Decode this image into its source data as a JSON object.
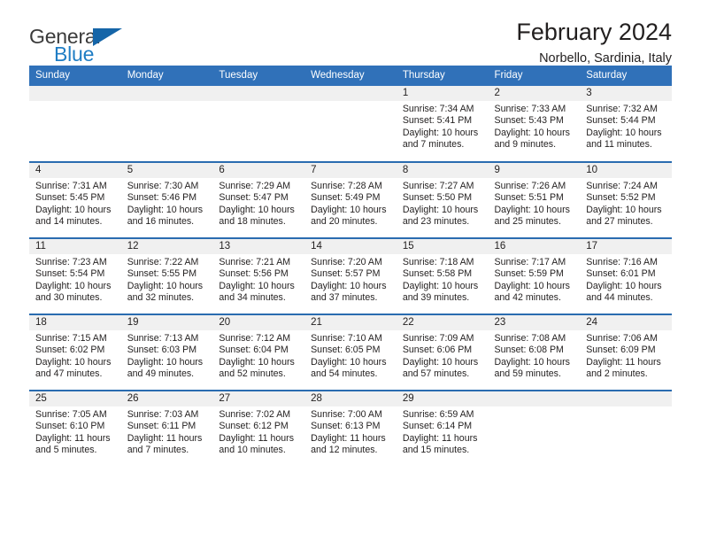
{
  "brand": {
    "name_top": "General",
    "name_bottom": "Blue",
    "triangle_icon": "triangle-icon",
    "color_dark": "#3b3b3b",
    "color_blue": "#1f7dc4",
    "triangle_color": "#1565a8"
  },
  "header": {
    "title": "February 2024",
    "subtitle": "Norbello, Sardinia, Italy"
  },
  "theme": {
    "header_bg": "#3071b9",
    "row_divider": "#2a6cb0",
    "day_band_bg": "#f0f0f0",
    "text": "#221f1f"
  },
  "weekday_headers": [
    "Sunday",
    "Monday",
    "Tuesday",
    "Wednesday",
    "Thursday",
    "Friday",
    "Saturday"
  ],
  "weeks": [
    [
      {
        "day": "",
        "empty": true,
        "line1": "",
        "line2": "",
        "line3": "",
        "line4": ""
      },
      {
        "day": "",
        "empty": true,
        "line1": "",
        "line2": "",
        "line3": "",
        "line4": ""
      },
      {
        "day": "",
        "empty": true,
        "line1": "",
        "line2": "",
        "line3": "",
        "line4": ""
      },
      {
        "day": "",
        "empty": true,
        "line1": "",
        "line2": "",
        "line3": "",
        "line4": ""
      },
      {
        "day": "1",
        "empty": false,
        "line1": "Sunrise: 7:34 AM",
        "line2": "Sunset: 5:41 PM",
        "line3": "Daylight: 10 hours",
        "line4": "and 7 minutes."
      },
      {
        "day": "2",
        "empty": false,
        "line1": "Sunrise: 7:33 AM",
        "line2": "Sunset: 5:43 PM",
        "line3": "Daylight: 10 hours",
        "line4": "and 9 minutes."
      },
      {
        "day": "3",
        "empty": false,
        "line1": "Sunrise: 7:32 AM",
        "line2": "Sunset: 5:44 PM",
        "line3": "Daylight: 10 hours",
        "line4": "and 11 minutes."
      }
    ],
    [
      {
        "day": "4",
        "empty": false,
        "line1": "Sunrise: 7:31 AM",
        "line2": "Sunset: 5:45 PM",
        "line3": "Daylight: 10 hours",
        "line4": "and 14 minutes."
      },
      {
        "day": "5",
        "empty": false,
        "line1": "Sunrise: 7:30 AM",
        "line2": "Sunset: 5:46 PM",
        "line3": "Daylight: 10 hours",
        "line4": "and 16 minutes."
      },
      {
        "day": "6",
        "empty": false,
        "line1": "Sunrise: 7:29 AM",
        "line2": "Sunset: 5:47 PM",
        "line3": "Daylight: 10 hours",
        "line4": "and 18 minutes."
      },
      {
        "day": "7",
        "empty": false,
        "line1": "Sunrise: 7:28 AM",
        "line2": "Sunset: 5:49 PM",
        "line3": "Daylight: 10 hours",
        "line4": "and 20 minutes."
      },
      {
        "day": "8",
        "empty": false,
        "line1": "Sunrise: 7:27 AM",
        "line2": "Sunset: 5:50 PM",
        "line3": "Daylight: 10 hours",
        "line4": "and 23 minutes."
      },
      {
        "day": "9",
        "empty": false,
        "line1": "Sunrise: 7:26 AM",
        "line2": "Sunset: 5:51 PM",
        "line3": "Daylight: 10 hours",
        "line4": "and 25 minutes."
      },
      {
        "day": "10",
        "empty": false,
        "line1": "Sunrise: 7:24 AM",
        "line2": "Sunset: 5:52 PM",
        "line3": "Daylight: 10 hours",
        "line4": "and 27 minutes."
      }
    ],
    [
      {
        "day": "11",
        "empty": false,
        "line1": "Sunrise: 7:23 AM",
        "line2": "Sunset: 5:54 PM",
        "line3": "Daylight: 10 hours",
        "line4": "and 30 minutes."
      },
      {
        "day": "12",
        "empty": false,
        "line1": "Sunrise: 7:22 AM",
        "line2": "Sunset: 5:55 PM",
        "line3": "Daylight: 10 hours",
        "line4": "and 32 minutes."
      },
      {
        "day": "13",
        "empty": false,
        "line1": "Sunrise: 7:21 AM",
        "line2": "Sunset: 5:56 PM",
        "line3": "Daylight: 10 hours",
        "line4": "and 34 minutes."
      },
      {
        "day": "14",
        "empty": false,
        "line1": "Sunrise: 7:20 AM",
        "line2": "Sunset: 5:57 PM",
        "line3": "Daylight: 10 hours",
        "line4": "and 37 minutes."
      },
      {
        "day": "15",
        "empty": false,
        "line1": "Sunrise: 7:18 AM",
        "line2": "Sunset: 5:58 PM",
        "line3": "Daylight: 10 hours",
        "line4": "and 39 minutes."
      },
      {
        "day": "16",
        "empty": false,
        "line1": "Sunrise: 7:17 AM",
        "line2": "Sunset: 5:59 PM",
        "line3": "Daylight: 10 hours",
        "line4": "and 42 minutes."
      },
      {
        "day": "17",
        "empty": false,
        "line1": "Sunrise: 7:16 AM",
        "line2": "Sunset: 6:01 PM",
        "line3": "Daylight: 10 hours",
        "line4": "and 44 minutes."
      }
    ],
    [
      {
        "day": "18",
        "empty": false,
        "line1": "Sunrise: 7:15 AM",
        "line2": "Sunset: 6:02 PM",
        "line3": "Daylight: 10 hours",
        "line4": "and 47 minutes."
      },
      {
        "day": "19",
        "empty": false,
        "line1": "Sunrise: 7:13 AM",
        "line2": "Sunset: 6:03 PM",
        "line3": "Daylight: 10 hours",
        "line4": "and 49 minutes."
      },
      {
        "day": "20",
        "empty": false,
        "line1": "Sunrise: 7:12 AM",
        "line2": "Sunset: 6:04 PM",
        "line3": "Daylight: 10 hours",
        "line4": "and 52 minutes."
      },
      {
        "day": "21",
        "empty": false,
        "line1": "Sunrise: 7:10 AM",
        "line2": "Sunset: 6:05 PM",
        "line3": "Daylight: 10 hours",
        "line4": "and 54 minutes."
      },
      {
        "day": "22",
        "empty": false,
        "line1": "Sunrise: 7:09 AM",
        "line2": "Sunset: 6:06 PM",
        "line3": "Daylight: 10 hours",
        "line4": "and 57 minutes."
      },
      {
        "day": "23",
        "empty": false,
        "line1": "Sunrise: 7:08 AM",
        "line2": "Sunset: 6:08 PM",
        "line3": "Daylight: 10 hours",
        "line4": "and 59 minutes."
      },
      {
        "day": "24",
        "empty": false,
        "line1": "Sunrise: 7:06 AM",
        "line2": "Sunset: 6:09 PM",
        "line3": "Daylight: 11 hours",
        "line4": "and 2 minutes."
      }
    ],
    [
      {
        "day": "25",
        "empty": false,
        "line1": "Sunrise: 7:05 AM",
        "line2": "Sunset: 6:10 PM",
        "line3": "Daylight: 11 hours",
        "line4": "and 5 minutes."
      },
      {
        "day": "26",
        "empty": false,
        "line1": "Sunrise: 7:03 AM",
        "line2": "Sunset: 6:11 PM",
        "line3": "Daylight: 11 hours",
        "line4": "and 7 minutes."
      },
      {
        "day": "27",
        "empty": false,
        "line1": "Sunrise: 7:02 AM",
        "line2": "Sunset: 6:12 PM",
        "line3": "Daylight: 11 hours",
        "line4": "and 10 minutes."
      },
      {
        "day": "28",
        "empty": false,
        "line1": "Sunrise: 7:00 AM",
        "line2": "Sunset: 6:13 PM",
        "line3": "Daylight: 11 hours",
        "line4": "and 12 minutes."
      },
      {
        "day": "29",
        "empty": false,
        "line1": "Sunrise: 6:59 AM",
        "line2": "Sunset: 6:14 PM",
        "line3": "Daylight: 11 hours",
        "line4": "and 15 minutes."
      },
      {
        "day": "",
        "empty": true,
        "line1": "",
        "line2": "",
        "line3": "",
        "line4": ""
      },
      {
        "day": "",
        "empty": true,
        "line1": "",
        "line2": "",
        "line3": "",
        "line4": ""
      }
    ]
  ]
}
